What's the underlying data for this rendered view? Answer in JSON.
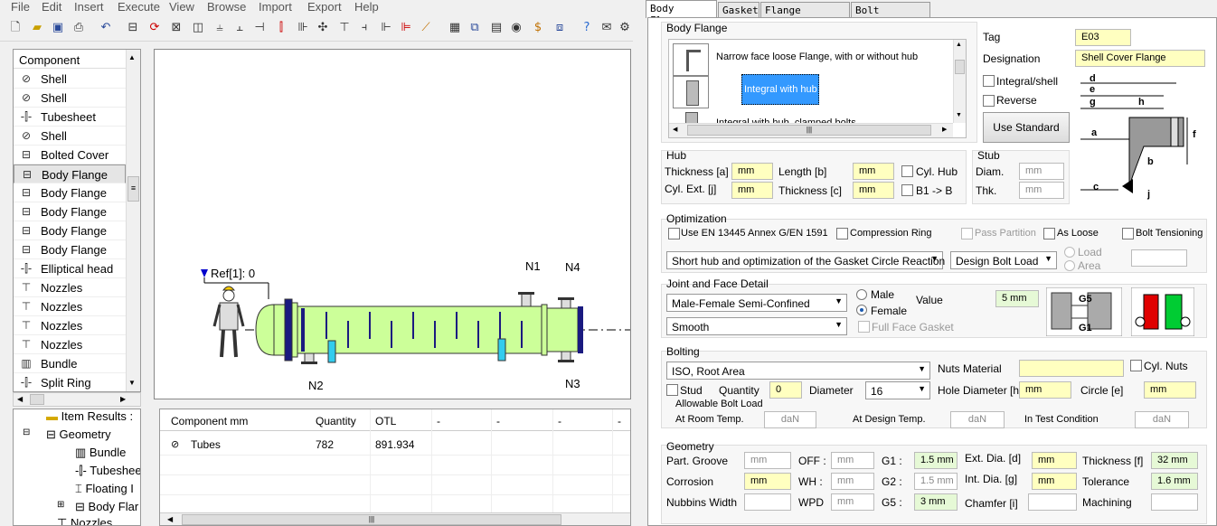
{
  "menu": [
    "File",
    "Edit",
    "Insert",
    "Execute",
    "View",
    "Browse",
    "Import",
    "Export",
    "Help"
  ],
  "component_list": {
    "header": "Component",
    "items": [
      {
        "icon": "shell-icon",
        "label": "Shell"
      },
      {
        "icon": "shell-icon",
        "label": "Shell"
      },
      {
        "icon": "tubesheet-icon",
        "label": "Tubesheet"
      },
      {
        "icon": "shell-icon",
        "label": "Shell"
      },
      {
        "icon": "flange-icon",
        "label": "Bolted Cover"
      },
      {
        "icon": "flange-icon",
        "label": "Body Flange"
      },
      {
        "icon": "flange-icon",
        "label": "Body Flange"
      },
      {
        "icon": "flange-icon",
        "label": "Body Flange"
      },
      {
        "icon": "flange-icon",
        "label": "Body Flange"
      },
      {
        "icon": "flange-icon",
        "label": "Body Flange"
      },
      {
        "icon": "tubesheet-icon",
        "label": "Elliptical head"
      },
      {
        "icon": "nozzle-icon",
        "label": "Nozzles"
      },
      {
        "icon": "nozzle-icon",
        "label": "Nozzles"
      },
      {
        "icon": "nozzle-icon",
        "label": "Nozzles"
      },
      {
        "icon": "nozzle-icon",
        "label": "Nozzles"
      },
      {
        "icon": "bundle-icon",
        "label": "Bundle"
      },
      {
        "icon": "tubesheet-icon",
        "label": "Split Ring"
      }
    ]
  },
  "tree": {
    "item_results": "Item Results :",
    "geometry": "Geometry",
    "bundle": "Bundle",
    "tubesheet": "Tubeshee",
    "floating": "Floating I",
    "body_flange": "Body Flar",
    "nozzles": "Nozzles"
  },
  "drawing": {
    "ref": "Ref[1]: 0",
    "n1": "N1",
    "n2": "N2",
    "n3": "N3",
    "n4": "N4"
  },
  "result_table": {
    "headers": [
      "Component mm",
      "Quantity",
      "OTL",
      "-",
      "-",
      "-",
      "-"
    ],
    "rows": [
      [
        "Tubes",
        "782",
        "891.934"
      ]
    ]
  },
  "tabs": [
    "Body Flange",
    "Gasket",
    "Flange Material",
    "Bolt Material"
  ],
  "body_flange": {
    "group_label": "Body Flange",
    "types": [
      "Narrow face loose Flange, with or without hub",
      "Integral with hub",
      "Integral with hub, clamped bolts"
    ],
    "tag_label": "Tag",
    "tag_value": "E03",
    "designation_label": "Designation",
    "designation_value": "Shell Cover Flange",
    "integral_shell": "Integral/shell",
    "reverse": "Reverse",
    "use_standard": "Use Standard",
    "dim_letters": [
      "d",
      "e",
      "g",
      "h",
      "a",
      "f",
      "b",
      "c",
      "j"
    ]
  },
  "hub": {
    "label": "Hub",
    "thickness_a": "Thickness [a]",
    "length_b": "Length [b]",
    "cyl_ext_j": "Cyl. Ext. [j]",
    "thickness_c": "Thickness [c]",
    "unit": "mm",
    "cyl_hub": "Cyl. Hub",
    "b1_b": "B1 -> B"
  },
  "stub": {
    "label": "Stub",
    "diam": "Diam.",
    "thk": "Thk.",
    "unit": "mm"
  },
  "optimization": {
    "label": "Optimization",
    "use_en": "Use EN 13445 Annex G/EN 1591",
    "compression_ring": "Compression Ring",
    "pass_partition": "Pass Partition",
    "as_loose": "As Loose",
    "bolt_tensioning": "Bolt Tensioning",
    "method": "Short hub and optimization of the Gasket Circle Reaction",
    "design_bolt_load": "Design Bolt Load",
    "load": "Load",
    "area": "Area"
  },
  "joint": {
    "label": "Joint and Face Detail",
    "type": "Male-Female Semi-Confined",
    "finish": "Smooth",
    "male": "Male",
    "female": "Female",
    "full_face": "Full Face Gasket",
    "value_label": "Value",
    "value": "5 mm",
    "g5": "G5",
    "g1": "G1"
  },
  "bolting": {
    "label": "Bolting",
    "thread": "ISO, Root Area",
    "nuts_material": "Nuts Material",
    "cyl_nuts": "Cyl. Nuts",
    "stud": "Stud",
    "quantity_label": "Quantity",
    "quantity": "0",
    "diameter_label": "Diameter",
    "diameter": "16",
    "hole_diameter": "Hole Diameter [h]",
    "circle": "Circle [e]",
    "unit_mm": "mm",
    "allowable": "Allowable Bolt Load",
    "at_room": "At Room Temp.",
    "at_design": "At Design Temp.",
    "at_test": "In Test Condition",
    "unit_dan": "daN"
  },
  "geometry": {
    "label": "Geometry",
    "part_groove": "Part. Groove",
    "off": "OFF :",
    "g1": "G1 :",
    "ext_dia": "Ext. Dia. [d]",
    "thickness_f": "Thickness [f]",
    "corrosion": "Corrosion",
    "wh": "WH :",
    "g2": "G2 :",
    "int_dia": "Int. Dia. [g]",
    "tolerance": "Tolerance",
    "nubbins": "Nubbins Width",
    "wpd": "WPD",
    "g5": "G5 :",
    "chamfer": "Chamfer [i]",
    "machining": "Machining",
    "mm": "mm",
    "g1_val": "1.5 mm",
    "g2_val": "1.5 mm",
    "g5_val": "3 mm",
    "thickness_val": "32 mm",
    "tolerance_val": "1.6 mm"
  },
  "colors": {
    "field_yellow": "#ffffc0",
    "field_green": "#e6f9d6",
    "shell_green": "#ccff99",
    "nozzle_cyan": "#33ccee",
    "selection_blue": "#3399ff"
  }
}
